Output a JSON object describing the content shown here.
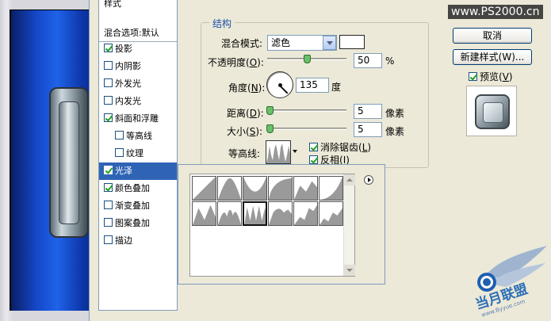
{
  "watermark": "www.PS2000.cn",
  "style_list": {
    "items": [
      {
        "label": "样式",
        "checkbox": false,
        "checked": false,
        "sub": false,
        "selected": false
      },
      {
        "label": "混合选项:默认",
        "checkbox": false,
        "checked": false,
        "sub": false,
        "selected": false
      },
      {
        "label": "投影",
        "checkbox": true,
        "checked": true,
        "sub": false,
        "selected": false
      },
      {
        "label": "内阴影",
        "checkbox": true,
        "checked": false,
        "sub": false,
        "selected": false
      },
      {
        "label": "外发光",
        "checkbox": true,
        "checked": false,
        "sub": false,
        "selected": false
      },
      {
        "label": "内发光",
        "checkbox": true,
        "checked": false,
        "sub": false,
        "selected": false
      },
      {
        "label": "斜面和浮雕",
        "checkbox": true,
        "checked": true,
        "sub": false,
        "selected": false
      },
      {
        "label": "等高线",
        "checkbox": true,
        "checked": false,
        "sub": true,
        "selected": false
      },
      {
        "label": "纹理",
        "checkbox": true,
        "checked": false,
        "sub": true,
        "selected": false
      },
      {
        "label": "光泽",
        "checkbox": true,
        "checked": true,
        "sub": false,
        "selected": true
      },
      {
        "label": "颜色叠加",
        "checkbox": true,
        "checked": true,
        "sub": false,
        "selected": false
      },
      {
        "label": "渐变叠加",
        "checkbox": true,
        "checked": false,
        "sub": false,
        "selected": false
      },
      {
        "label": "图案叠加",
        "checkbox": true,
        "checked": false,
        "sub": false,
        "selected": false
      },
      {
        "label": "描边",
        "checkbox": true,
        "checked": false,
        "sub": false,
        "selected": false
      }
    ]
  },
  "structure": {
    "title": "结构",
    "blend_mode": {
      "label": "混合模式:",
      "value": "滤色"
    },
    "opacity": {
      "label_pre": "不透明度(",
      "key": "O",
      "label_post": "):",
      "value": "50",
      "unit": "%",
      "fraction": 0.5
    },
    "angle": {
      "label_pre": "角度(",
      "key": "N",
      "label_post": "):",
      "value": "135",
      "unit": "度"
    },
    "distance": {
      "label_pre": "距离(",
      "key": "D",
      "label_post": "):",
      "value": "5",
      "unit": "像素"
    },
    "size": {
      "label_pre": "大小(",
      "key": "S",
      "label_post": "):",
      "value": "5",
      "unit": "像素"
    },
    "contour": {
      "label": "等高线:"
    },
    "anti_alias": {
      "label_pre": "消除锯齿(",
      "key": "L",
      "label_post": ")",
      "checked": true
    },
    "invert": {
      "label_pre": "反相(",
      "key": "I",
      "label_post": ")",
      "checked": true
    }
  },
  "buttons": {
    "cancel": "取消",
    "new_style": "新建样式(W)...",
    "preview_pre": "预览(",
    "preview_key": "V",
    "preview_post": ")"
  },
  "logo": {
    "text": "当月联盟",
    "sub": "www.Byyue.com"
  }
}
